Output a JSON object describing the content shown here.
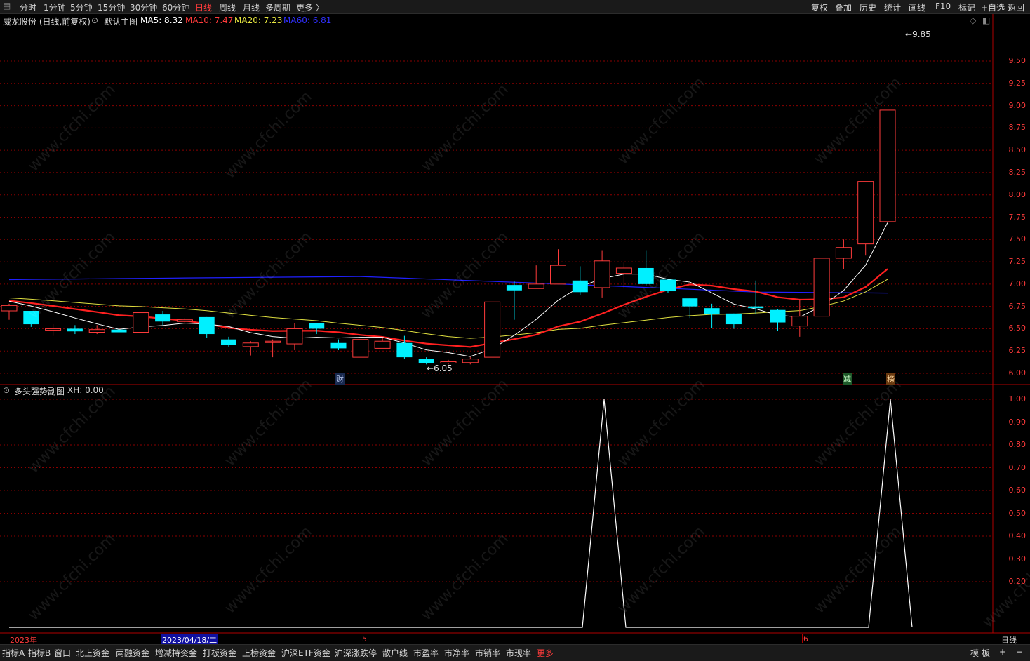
{
  "toolbar": {
    "periods": [
      "分时",
      "1分钟",
      "5分钟",
      "15分钟",
      "30分钟",
      "60分钟",
      "日线",
      "周线",
      "月线",
      "多周期",
      "更多 〉"
    ],
    "active_period": "日线",
    "right_buttons": [
      "复权",
      "叠加",
      "历史",
      "统计",
      "画线",
      "F10",
      "标记",
      "+自选",
      "返回"
    ]
  },
  "main_info": {
    "stock": "威龙股份 (日线,前复权)",
    "template": "默认主图",
    "ma5": "MA5: 8.32",
    "ma10": "MA10: 7.47",
    "ma20": "MA20: 7.23",
    "ma60": "MA60: 6.81"
  },
  "sub_info": {
    "indicator": "多头强势副图",
    "value": "XH: 0.00"
  },
  "annotations": {
    "high_label": "9.85",
    "low_label": "6.05",
    "marker_cai": "财",
    "marker_jian": "减",
    "marker_bang": "榜"
  },
  "main_axis": [
    "9.50",
    "9.25",
    "9.00",
    "8.75",
    "8.50",
    "8.25",
    "8.00",
    "7.75",
    "7.50",
    "7.25",
    "7.00",
    "6.75",
    "6.50",
    "6.25",
    "6.00"
  ],
  "sub_axis": [
    "1.00",
    "0.90",
    "0.80",
    "0.70",
    "0.60",
    "0.50",
    "0.40",
    "0.30",
    "0.20"
  ],
  "x_axis": {
    "year": "2023年",
    "cursor_date": "2023/04/18/二",
    "month5": "5",
    "month6": "6",
    "period_label": "日线"
  },
  "bottom_tabs": [
    "指标A",
    "指标B",
    "窗口",
    "北上资金",
    "两融资金",
    "增减持资金",
    "打板资金",
    "上榜资金",
    "沪深ETF资金",
    "沪深涨跌停",
    "散户线",
    "市盈率",
    "市净率",
    "市销率",
    "市现率",
    "更多"
  ],
  "bottom_right": [
    "模",
    "板",
    "+",
    "−"
  ],
  "watermark": "www.cfchi.com",
  "colors": {
    "up": "#ff3b3b",
    "down": "#00f0ff",
    "ma5": "#ffffff",
    "ma10": "#ff2020",
    "ma20": "#e0e040",
    "ma60": "#2020ff",
    "grid": "#8b0000"
  },
  "chart_data": [
    {
      "type": "candlestick",
      "title": "威龙股份 (日线,前复权)",
      "ylim": [
        6.0,
        9.5
      ],
      "candles": [
        {
          "o": 6.7,
          "h": 6.78,
          "l": 6.6,
          "c": 6.76
        },
        {
          "o": 6.7,
          "h": 6.7,
          "l": 6.52,
          "c": 6.55
        },
        {
          "o": 6.5,
          "h": 6.55,
          "l": 6.42,
          "c": 6.5
        },
        {
          "o": 6.5,
          "h": 6.54,
          "l": 6.44,
          "c": 6.47
        },
        {
          "o": 6.46,
          "h": 6.54,
          "l": 6.44,
          "c": 6.49
        },
        {
          "o": 6.49,
          "h": 6.53,
          "l": 6.45,
          "c": 6.46
        },
        {
          "o": 6.46,
          "h": 6.68,
          "l": 6.46,
          "c": 6.68
        },
        {
          "o": 6.66,
          "h": 6.7,
          "l": 6.54,
          "c": 6.58
        },
        {
          "o": 6.58,
          "h": 6.62,
          "l": 6.55,
          "c": 6.6
        },
        {
          "o": 6.63,
          "h": 6.63,
          "l": 6.4,
          "c": 6.44
        },
        {
          "o": 6.38,
          "h": 6.41,
          "l": 6.3,
          "c": 6.32
        },
        {
          "o": 6.3,
          "h": 6.36,
          "l": 6.2,
          "c": 6.34
        },
        {
          "o": 6.36,
          "h": 6.38,
          "l": 6.18,
          "c": 6.36
        },
        {
          "o": 6.33,
          "h": 6.56,
          "l": 6.26,
          "c": 6.5
        },
        {
          "o": 6.56,
          "h": 6.56,
          "l": 6.44,
          "c": 6.5
        },
        {
          "o": 6.34,
          "h": 6.38,
          "l": 6.26,
          "c": 6.28
        },
        {
          "o": 6.18,
          "h": 6.38,
          "l": 6.18,
          "c": 6.38
        },
        {
          "o": 6.28,
          "h": 6.4,
          "l": 6.28,
          "c": 6.36
        },
        {
          "o": 6.34,
          "h": 6.42,
          "l": 6.16,
          "c": 6.18
        },
        {
          "o": 6.16,
          "h": 6.18,
          "l": 6.1,
          "c": 6.11
        },
        {
          "o": 6.13,
          "h": 6.15,
          "l": 6.1,
          "c": 6.13
        },
        {
          "o": 6.12,
          "h": 6.18,
          "l": 6.1,
          "c": 6.16
        },
        {
          "o": 6.18,
          "h": 6.8,
          "l": 6.18,
          "c": 6.8
        },
        {
          "o": 6.99,
          "h": 7.03,
          "l": 6.6,
          "c": 6.93
        },
        {
          "o": 6.95,
          "h": 7.21,
          "l": 6.95,
          "c": 7.0
        },
        {
          "o": 7.0,
          "h": 7.39,
          "l": 7.0,
          "c": 7.21
        },
        {
          "o": 7.04,
          "h": 7.2,
          "l": 6.88,
          "c": 6.91
        },
        {
          "o": 6.96,
          "h": 7.38,
          "l": 6.85,
          "c": 7.26
        },
        {
          "o": 7.12,
          "h": 7.24,
          "l": 6.95,
          "c": 7.18
        },
        {
          "o": 7.18,
          "h": 7.38,
          "l": 6.98,
          "c": 7.0
        },
        {
          "o": 7.05,
          "h": 7.05,
          "l": 6.9,
          "c": 6.92
        },
        {
          "o": 6.84,
          "h": 6.84,
          "l": 6.62,
          "c": 6.75
        },
        {
          "o": 6.73,
          "h": 6.78,
          "l": 6.51,
          "c": 6.66
        },
        {
          "o": 6.67,
          "h": 6.67,
          "l": 6.5,
          "c": 6.55
        },
        {
          "o": 6.75,
          "h": 7.04,
          "l": 6.66,
          "c": 6.73
        },
        {
          "o": 6.71,
          "h": 6.72,
          "l": 6.48,
          "c": 6.57
        },
        {
          "o": 6.53,
          "h": 6.83,
          "l": 6.41,
          "c": 6.64
        },
        {
          "o": 6.64,
          "h": 7.29,
          "l": 6.64,
          "c": 7.29
        },
        {
          "o": 7.29,
          "h": 7.5,
          "l": 7.17,
          "c": 7.41
        },
        {
          "o": 7.45,
          "h": 8.15,
          "l": 7.32,
          "c": 8.15
        },
        {
          "o": 7.7,
          "h": 8.95,
          "l": 7.7,
          "c": 8.95
        }
      ]
    },
    {
      "type": "line",
      "title": "多头强势副图",
      "ylim": [
        0,
        1
      ],
      "series": [
        {
          "name": "XH",
          "x": [
            0,
            26,
            27,
            28,
            39,
            40,
            41
          ],
          "values": [
            0,
            0,
            1,
            0,
            0,
            1,
            0
          ]
        }
      ]
    }
  ]
}
